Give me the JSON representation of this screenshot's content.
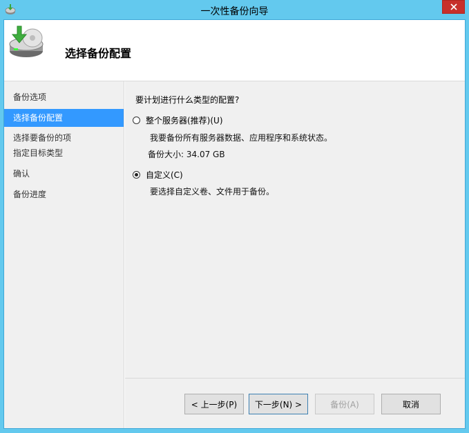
{
  "window": {
    "title": "一次性备份向导"
  },
  "header": {
    "page_title": "选择备份配置"
  },
  "nav": {
    "items": [
      {
        "label": "备份选项"
      },
      {
        "label": "选择备份配置"
      },
      {
        "label": "选择要备份的项"
      },
      {
        "label": "指定目标类型"
      },
      {
        "label": "确认"
      },
      {
        "label": "备份进度"
      }
    ],
    "active_index": 1
  },
  "main": {
    "question": "要计划进行什么类型的配置?",
    "options": [
      {
        "label": "整个服务器(推荐)(U)",
        "description": "我要备份所有服务器数据、应用程序和系统状态。",
        "size_text": "备份大小: 34.07 GB",
        "checked": false
      },
      {
        "label": "自定义(C)",
        "description": "要选择自定义卷、文件用于备份。",
        "checked": true
      }
    ]
  },
  "footer": {
    "prev_label": "< 上一步(P)",
    "next_label": "下一步(N) >",
    "backup_label": "备份(A)",
    "cancel_label": "取消"
  },
  "colors": {
    "frame": "#63c9ee",
    "selection": "#3399ff",
    "close": "#c7302b"
  }
}
